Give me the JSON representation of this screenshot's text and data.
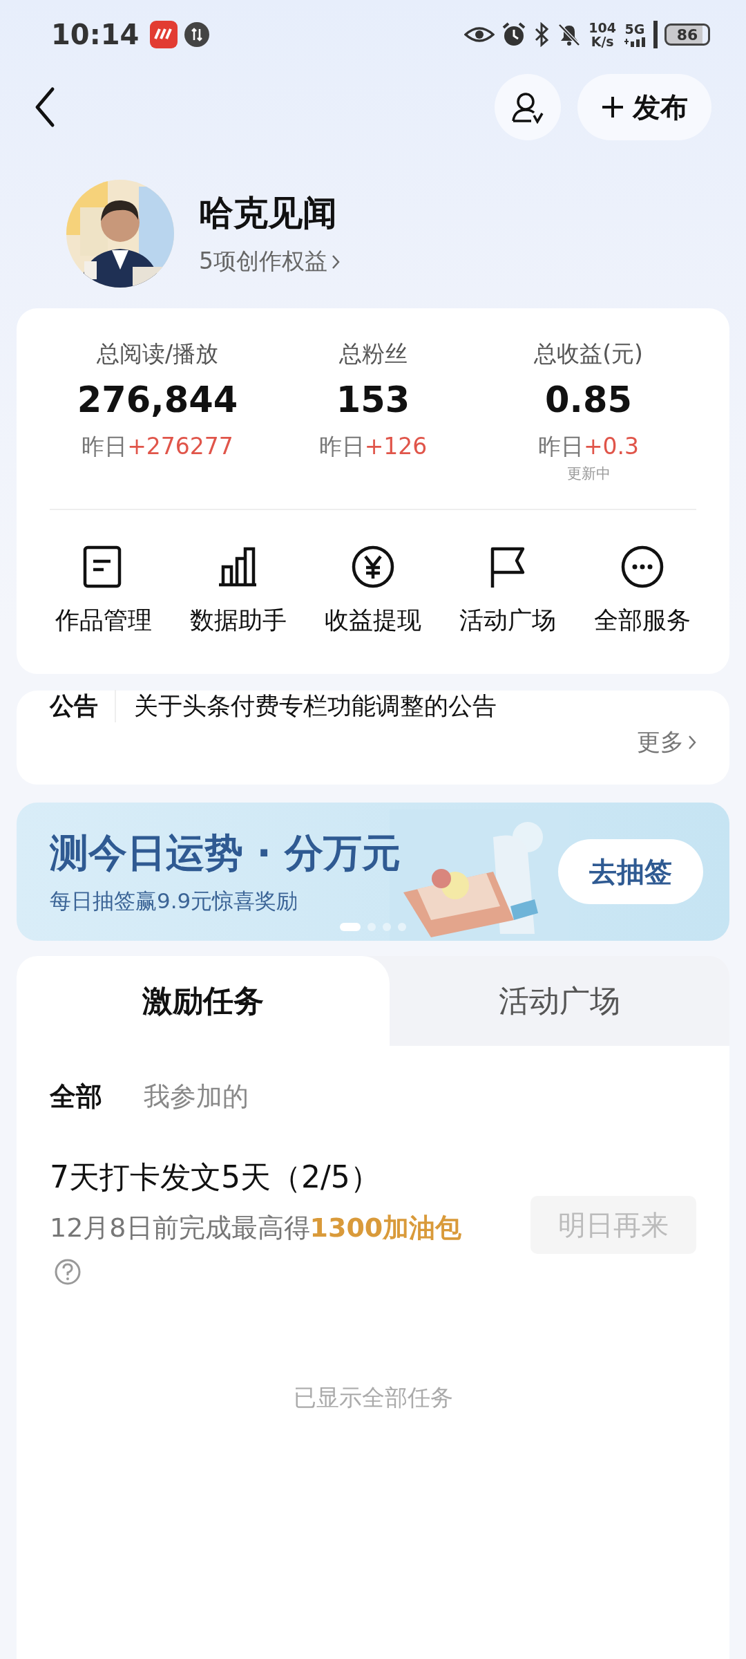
{
  "status_bar": {
    "time": "10:14",
    "speed_value": "104",
    "speed_unit": "K/s",
    "network": "5G",
    "battery": "86"
  },
  "header": {
    "publish_button": "发布"
  },
  "profile": {
    "name": "哈克见闻",
    "benefits_link": "5项创作权益"
  },
  "stats": [
    {
      "label": "总阅读/播放",
      "value": "276,844",
      "yesterday_label": "昨日",
      "yesterday_change": "+276277"
    },
    {
      "label": "总粉丝",
      "value": "153",
      "yesterday_label": "昨日",
      "yesterday_change": "+126"
    },
    {
      "label": "总收益(元)",
      "value": "0.85",
      "yesterday_label": "昨日",
      "yesterday_change": "+0.3",
      "note": "更新中"
    }
  ],
  "services": [
    {
      "label": "作品管理"
    },
    {
      "label": "数据助手"
    },
    {
      "label": "收益提现"
    },
    {
      "label": "活动广场"
    },
    {
      "label": "全部服务"
    }
  ],
  "notice": {
    "tag": "公告",
    "text": "关于头条付费专栏功能调整的公告",
    "more_link": "更多"
  },
  "banner": {
    "title": "测今日运势 · 分万元",
    "subtitle": "每日抽签赢9.9元惊喜奖励",
    "button": "去抽签",
    "dots": [
      {
        "selected": true
      },
      {
        "selected": false
      },
      {
        "selected": false
      },
      {
        "selected": false
      }
    ]
  },
  "tabs": [
    {
      "label": "激励任务",
      "selected": true
    },
    {
      "label": "活动广场",
      "selected": false
    }
  ],
  "filters": [
    {
      "label": "全部",
      "selected": true
    },
    {
      "label": "我参加的",
      "selected": false
    }
  ],
  "tasks": [
    {
      "title": "7天打卡发文5天（2/5）",
      "description": "12月8日前完成最高得",
      "reward": "1300加油包",
      "button": "明日再来",
      "disabled": true
    }
  ],
  "footer_note": "已显示全部任务"
}
